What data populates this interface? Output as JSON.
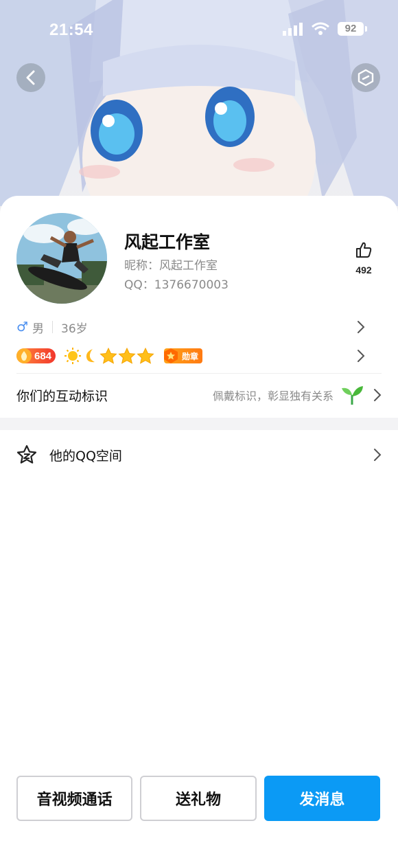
{
  "status_bar": {
    "time": "21:54",
    "battery": "92"
  },
  "profile": {
    "name": "风起工作室",
    "nickname": "昵称：风起工作室",
    "qq": "QQ：1376670003",
    "likes": "492",
    "gender_icon": "♂",
    "gender": "男",
    "age": "36岁"
  },
  "level": {
    "vip_value": "684",
    "medal_label": "勋章"
  },
  "interaction": {
    "label": "你们的互动标识",
    "hint": "佩戴标识，彰显独有关系"
  },
  "qzone": {
    "label": "他的QQ空间"
  },
  "buttons": {
    "call": "音视频通话",
    "gift": "送礼物",
    "message": "发消息"
  },
  "colors": {
    "primary": "#0b9af5",
    "vip": "#f2372d",
    "medal": "#ff8a12"
  }
}
